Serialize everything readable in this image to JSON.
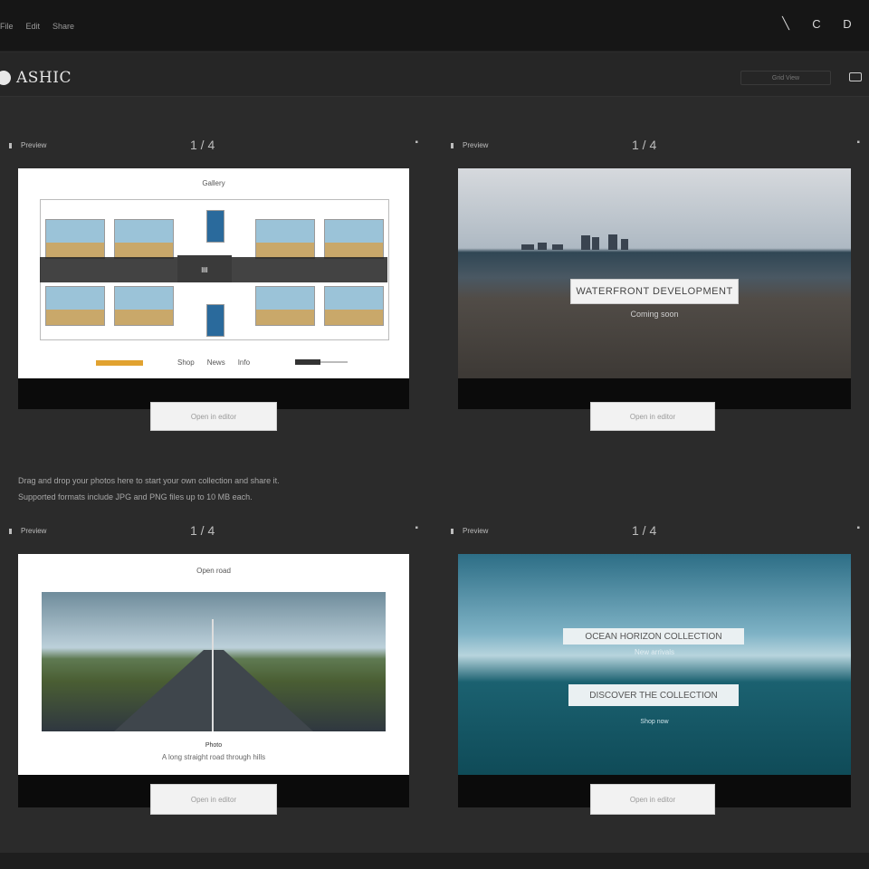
{
  "topbar": {
    "nav": [
      "File",
      "Edit",
      "Share"
    ],
    "icons": [
      "feather-icon",
      "refresh-icon",
      "menu-icon"
    ]
  },
  "app": {
    "logo": "ASHIC",
    "view_toggle": "Grid  View"
  },
  "panels": [
    {
      "label": "Preview",
      "counter": "1 / 4",
      "cta": "Open in editor",
      "title": "Gallery"
    },
    {
      "label": "Preview",
      "counter": "1 / 4",
      "cta": "Open in editor",
      "caption": "WATERFRONT DEVELOPMENT",
      "subcaption": "Coming soon"
    },
    {
      "label": "Preview",
      "counter": "1 / 4",
      "cta": "Open in editor",
      "title": "Open road",
      "caption_small": "Photo",
      "caption": "A long straight road through hills"
    },
    {
      "label": "Preview",
      "counter": "1 / 4",
      "cta": "Open in editor",
      "caption_primary": "OCEAN HORIZON COLLECTION",
      "subcaption_primary": "New arrivals",
      "caption_secondary": "DISCOVER THE COLLECTION",
      "subcaption_secondary": "Shop now"
    }
  ],
  "notice": {
    "line1": "Drag and drop your photos here to start your own collection and share it.",
    "line2": "Supported formats include JPG and PNG files up to 10 MB each."
  },
  "panel1_links": [
    "Shop",
    "News",
    "Info"
  ],
  "colors": {
    "accent": "#e1a230",
    "background": "#2b2b2b",
    "topbar": "#161616"
  }
}
